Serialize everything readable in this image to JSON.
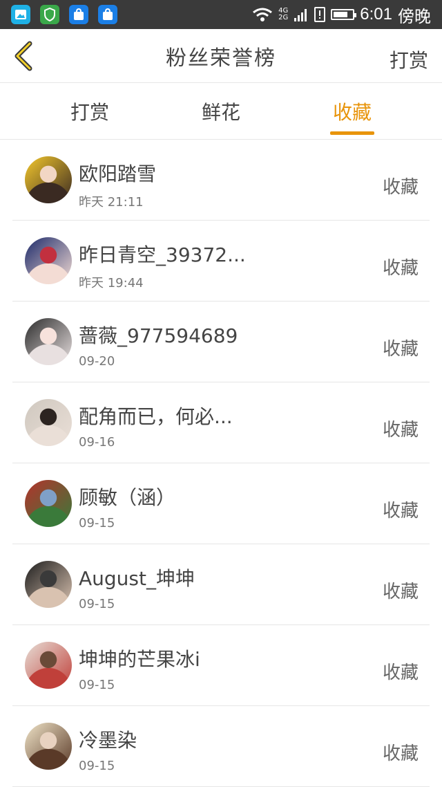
{
  "status_bar": {
    "net_top": "4G",
    "net_bottom": "2G",
    "time": "6:01",
    "period": "傍晚",
    "apps": [
      "gallery-app-icon",
      "shield-app-icon",
      "bag-app-icon",
      "bag-app-icon"
    ],
    "battery_level": 0.75
  },
  "header": {
    "title": "粉丝荣誉榜",
    "action_label": "打赏"
  },
  "tabs": [
    {
      "label": "打赏",
      "active": false
    },
    {
      "label": "鲜花",
      "active": false
    },
    {
      "label": "收藏",
      "active": true
    }
  ],
  "colors": {
    "accent": "#e8940b",
    "status_bar_bg": "#3a3a3a",
    "text": "#444444",
    "divider": "#e6e6e6"
  },
  "list": [
    {
      "name": "欧阳踏雪",
      "time": "昨天 21:11",
      "action": "收藏",
      "avatar_colors": [
        "#f4c82c",
        "#f2d6c4",
        "#3a2a22"
      ]
    },
    {
      "name": "昨日青空_39372...",
      "time": "昨天 19:44",
      "action": "收藏",
      "avatar_colors": [
        "#1d2a6a",
        "#c2303f",
        "#f3dcd4"
      ]
    },
    {
      "name": "蔷薇_977594689",
      "time": "09-20",
      "action": "收藏",
      "avatar_colors": [
        "#2c2c2c",
        "#f7e2dc",
        "#e8e0e0"
      ]
    },
    {
      "name": "配角而已，何必...",
      "time": "09-16",
      "action": "收藏",
      "avatar_colors": [
        "#cfc8bf",
        "#2c2420",
        "#eadfd7"
      ]
    },
    {
      "name": "顾敏（涵）",
      "time": "09-15",
      "action": "收藏",
      "avatar_colors": [
        "#b3332c",
        "#7fa0c8",
        "#3a7a3a"
      ]
    },
    {
      "name": "August_坤坤",
      "time": "09-15",
      "action": "收藏",
      "avatar_colors": [
        "#1e1e1e",
        "#3a3a3a",
        "#d9c2b0"
      ]
    },
    {
      "name": "坤坤的芒果冰i",
      "time": "09-15",
      "action": "收藏",
      "avatar_colors": [
        "#e7ded6",
        "#6a4a38",
        "#c0403a"
      ]
    },
    {
      "name": "冷墨染",
      "time": "09-15",
      "action": "收藏",
      "avatar_colors": [
        "#efe3c7",
        "#e8d2c0",
        "#5a3a28"
      ]
    }
  ]
}
